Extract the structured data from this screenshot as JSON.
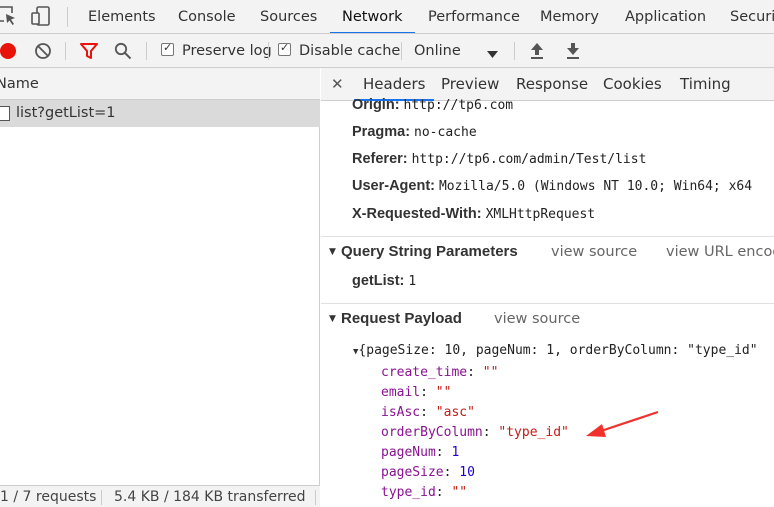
{
  "panel_tabs": [
    "Elements",
    "Console",
    "Sources",
    "Network",
    "Performance",
    "Memory",
    "Application",
    "Security"
  ],
  "active_panel_tab": "Network",
  "toolbar": {
    "preserve_log": "Preserve log",
    "disable_cache": "Disable cache",
    "throttle": "Online"
  },
  "request_list": {
    "column_header": "Name",
    "requests": [
      "list?getList=1"
    ]
  },
  "status_bar": {
    "requests": "1 / 7 requests",
    "transferred": "5.4 KB / 184 KB transferred"
  },
  "detail_tabs": [
    "Headers",
    "Preview",
    "Response",
    "Cookies",
    "Timing"
  ],
  "active_detail_tab": "Headers",
  "request_headers": [
    {
      "key": "Origin:",
      "value": "http://tp6.com"
    },
    {
      "key": "Pragma:",
      "value": "no-cache"
    },
    {
      "key": "Referer:",
      "value": "http://tp6.com/admin/Test/list"
    },
    {
      "key": "User-Agent:",
      "value": "Mozilla/5.0 (Windows NT 10.0; Win64; x64"
    },
    {
      "key": "X-Requested-With:",
      "value": "XMLHttpRequest"
    }
  ],
  "query_string": {
    "title": "Query String Parameters",
    "view_source": "view source",
    "view_url_encoded": "view URL encoded",
    "params": [
      {
        "key": "getList:",
        "value": "1"
      }
    ]
  },
  "request_payload": {
    "title": "Request Payload",
    "view_source": "view source",
    "summary": "{pageSize: 10, pageNum: 1, orderByColumn: \"type_id\"",
    "fields": [
      {
        "key": "create_time",
        "value": "\"\"",
        "type": "string"
      },
      {
        "key": "email",
        "value": "\"\"",
        "type": "string"
      },
      {
        "key": "isAsc",
        "value": "\"asc\"",
        "type": "string"
      },
      {
        "key": "orderByColumn",
        "value": "\"type_id\"",
        "type": "string"
      },
      {
        "key": "pageNum",
        "value": "1",
        "type": "number"
      },
      {
        "key": "pageSize",
        "value": "10",
        "type": "number"
      },
      {
        "key": "type_id",
        "value": "\"\"",
        "type": "string"
      }
    ]
  },
  "colors": {
    "accent_blue": "#1a73e8",
    "record_red": "#e8130b",
    "annotation_arrow": "#f0322d",
    "payload_key": "#881391",
    "payload_string": "#c41a16",
    "payload_number": "#1c00cf"
  },
  "icons": [
    "inspect-icon",
    "device-toolbar-icon",
    "record-icon",
    "clear-icon",
    "filter-icon",
    "search-icon",
    "dropdown-arrow-icon",
    "import-har-icon",
    "export-har-icon",
    "close-icon",
    "expand-triangle-icon",
    "annotation-arrow"
  ]
}
